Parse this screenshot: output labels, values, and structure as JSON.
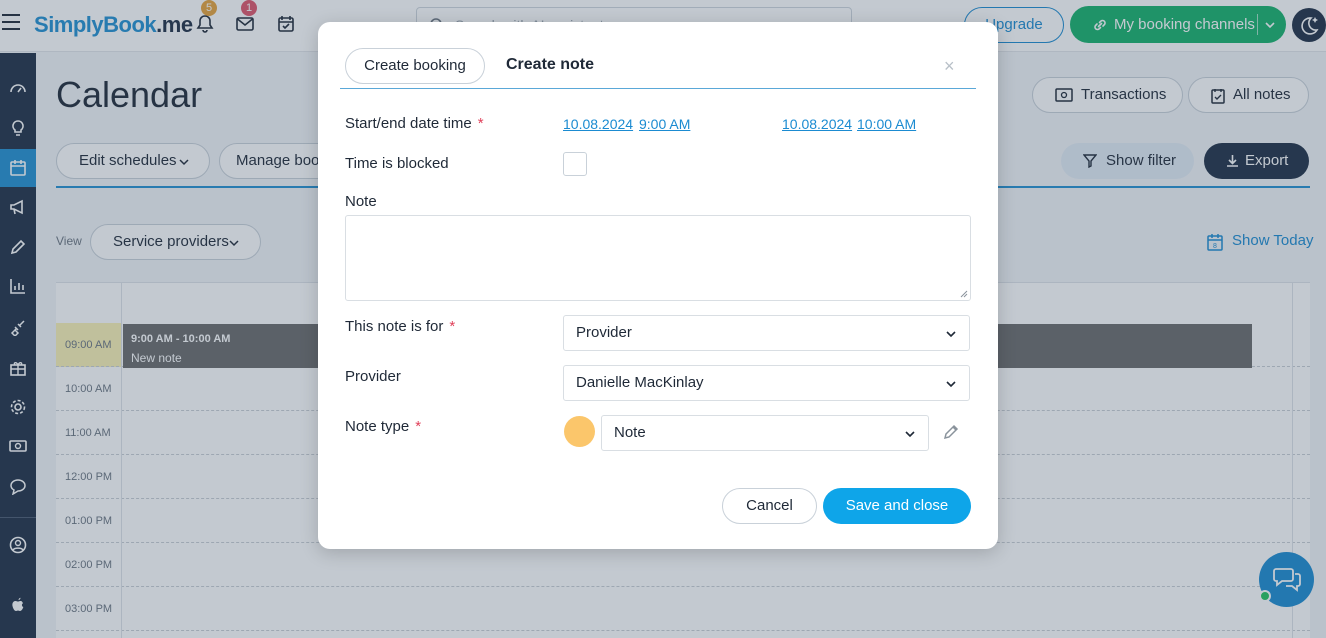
{
  "header": {
    "logo_first": "S",
    "logo_middle": "implyBook",
    "logo_suffix": ".me",
    "notifications_count": "5",
    "messages_count": "1",
    "search_placeholder": "Search with AI assistant",
    "upgrade_label": "Upgrade",
    "channels_label": "My booking channels"
  },
  "page": {
    "title": "Calendar",
    "transactions_label": "Transactions",
    "all_notes_label": "All notes",
    "edit_schedules_label": "Edit schedules",
    "manage_bookings_label": "Manage book",
    "show_filter_label": "Show filter",
    "export_label": "Export",
    "view_label": "View",
    "view_select": "Service providers",
    "show_today_label": "Show Today",
    "today_day": "8"
  },
  "calendar": {
    "hours": [
      "09:00 AM",
      "10:00 AM",
      "11:00 AM",
      "12:00 PM",
      "01:00 PM",
      "02:00 PM",
      "03:00 PM"
    ],
    "event": {
      "time": "9:00 AM - 10:00 AM",
      "title": "New note"
    }
  },
  "modal": {
    "tab_booking": "Create booking",
    "tab_note": "Create note",
    "close": "×",
    "start_end_label": "Start/end date time",
    "start_date": "10.08.2024",
    "start_time": "9:00 AM",
    "end_date": "10.08.2024",
    "end_time": "10:00 AM",
    "blocked_label": "Time is blocked",
    "note_label": "Note",
    "note_value": "",
    "note_for_label": "This note is for",
    "note_for_value": "Provider",
    "provider_label": "Provider",
    "provider_value": "Danielle MacKinlay",
    "note_type_label": "Note type",
    "note_type_value": "Note",
    "required_mark": "*",
    "cancel_label": "Cancel",
    "save_label": "Save and close"
  },
  "colors": {
    "accent": "#2190d1",
    "primary_dark": "#1f2f45",
    "success": "#15b26b",
    "note_color": "#fbc66b"
  }
}
